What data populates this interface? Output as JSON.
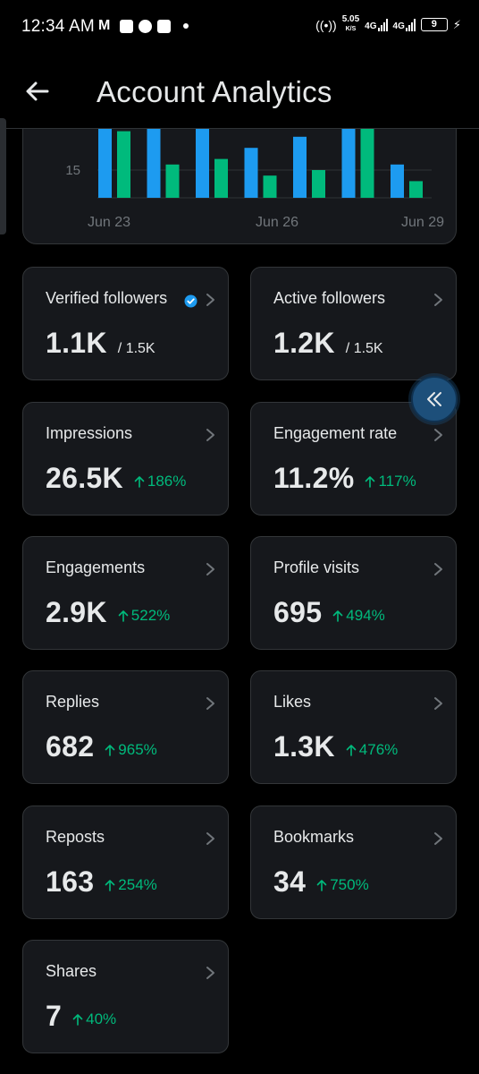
{
  "status_bar": {
    "time": "12:34 AM",
    "mail_icon": "M",
    "speed_value": "5.05",
    "speed_unit": "K/S",
    "net1": "4G",
    "net2": "4G",
    "battery": "9"
  },
  "header": {
    "title": "Account Analytics"
  },
  "chart_data": {
    "type": "bar",
    "x_tick_labels": [
      "Jun 23",
      "Jun 26",
      "Jun 29"
    ],
    "y_tick_labels": [
      "15"
    ],
    "categories": [
      "Jun 23",
      "Jun 24",
      "Jun 25",
      "Jun 26",
      "Jun 27",
      "Jun 28",
      "Jun 29"
    ],
    "series": [
      {
        "color": "#1d9bf0",
        "values": [
          35,
          35,
          35,
          19,
          21,
          35,
          16
        ]
      },
      {
        "color": "#00ba7c",
        "values": [
          22,
          16,
          17,
          14,
          15,
          26,
          13
        ]
      }
    ],
    "note_visible_range": [
      10,
      22
    ]
  },
  "cards": [
    {
      "label": "Verified followers",
      "value": "1.1K",
      "sub": "/ 1.5K",
      "verified": true
    },
    {
      "label": "Active followers",
      "value": "1.2K",
      "sub": "/ 1.5K"
    },
    {
      "label": "Impressions",
      "value": "26.5K",
      "change": "186%"
    },
    {
      "label": "Engagement rate",
      "value": "11.2%",
      "change": "117%"
    },
    {
      "label": "Engagements",
      "value": "2.9K",
      "change": "522%"
    },
    {
      "label": "Profile visits",
      "value": "695",
      "change": "494%"
    },
    {
      "label": "Replies",
      "value": "682",
      "change": "965%"
    },
    {
      "label": "Likes",
      "value": "1.3K",
      "change": "476%"
    },
    {
      "label": "Reposts",
      "value": "163",
      "change": "254%"
    },
    {
      "label": "Bookmarks",
      "value": "34",
      "change": "750%"
    },
    {
      "label": "Shares",
      "value": "7",
      "change": "40%"
    }
  ],
  "colors": {
    "background": "#000000",
    "card": "#16181c",
    "border": "#333639",
    "positive": "#00ba7c",
    "bar_blue": "#1d9bf0",
    "bar_green": "#00ba7c",
    "float_button": "#1d4f7a"
  },
  "icons": {
    "back": "arrow-left-icon",
    "chevron": "chevron-right-icon",
    "verified": "verified-badge-icon",
    "change": "arrow-up-icon",
    "collapse": "double-chevron-left-icon"
  }
}
